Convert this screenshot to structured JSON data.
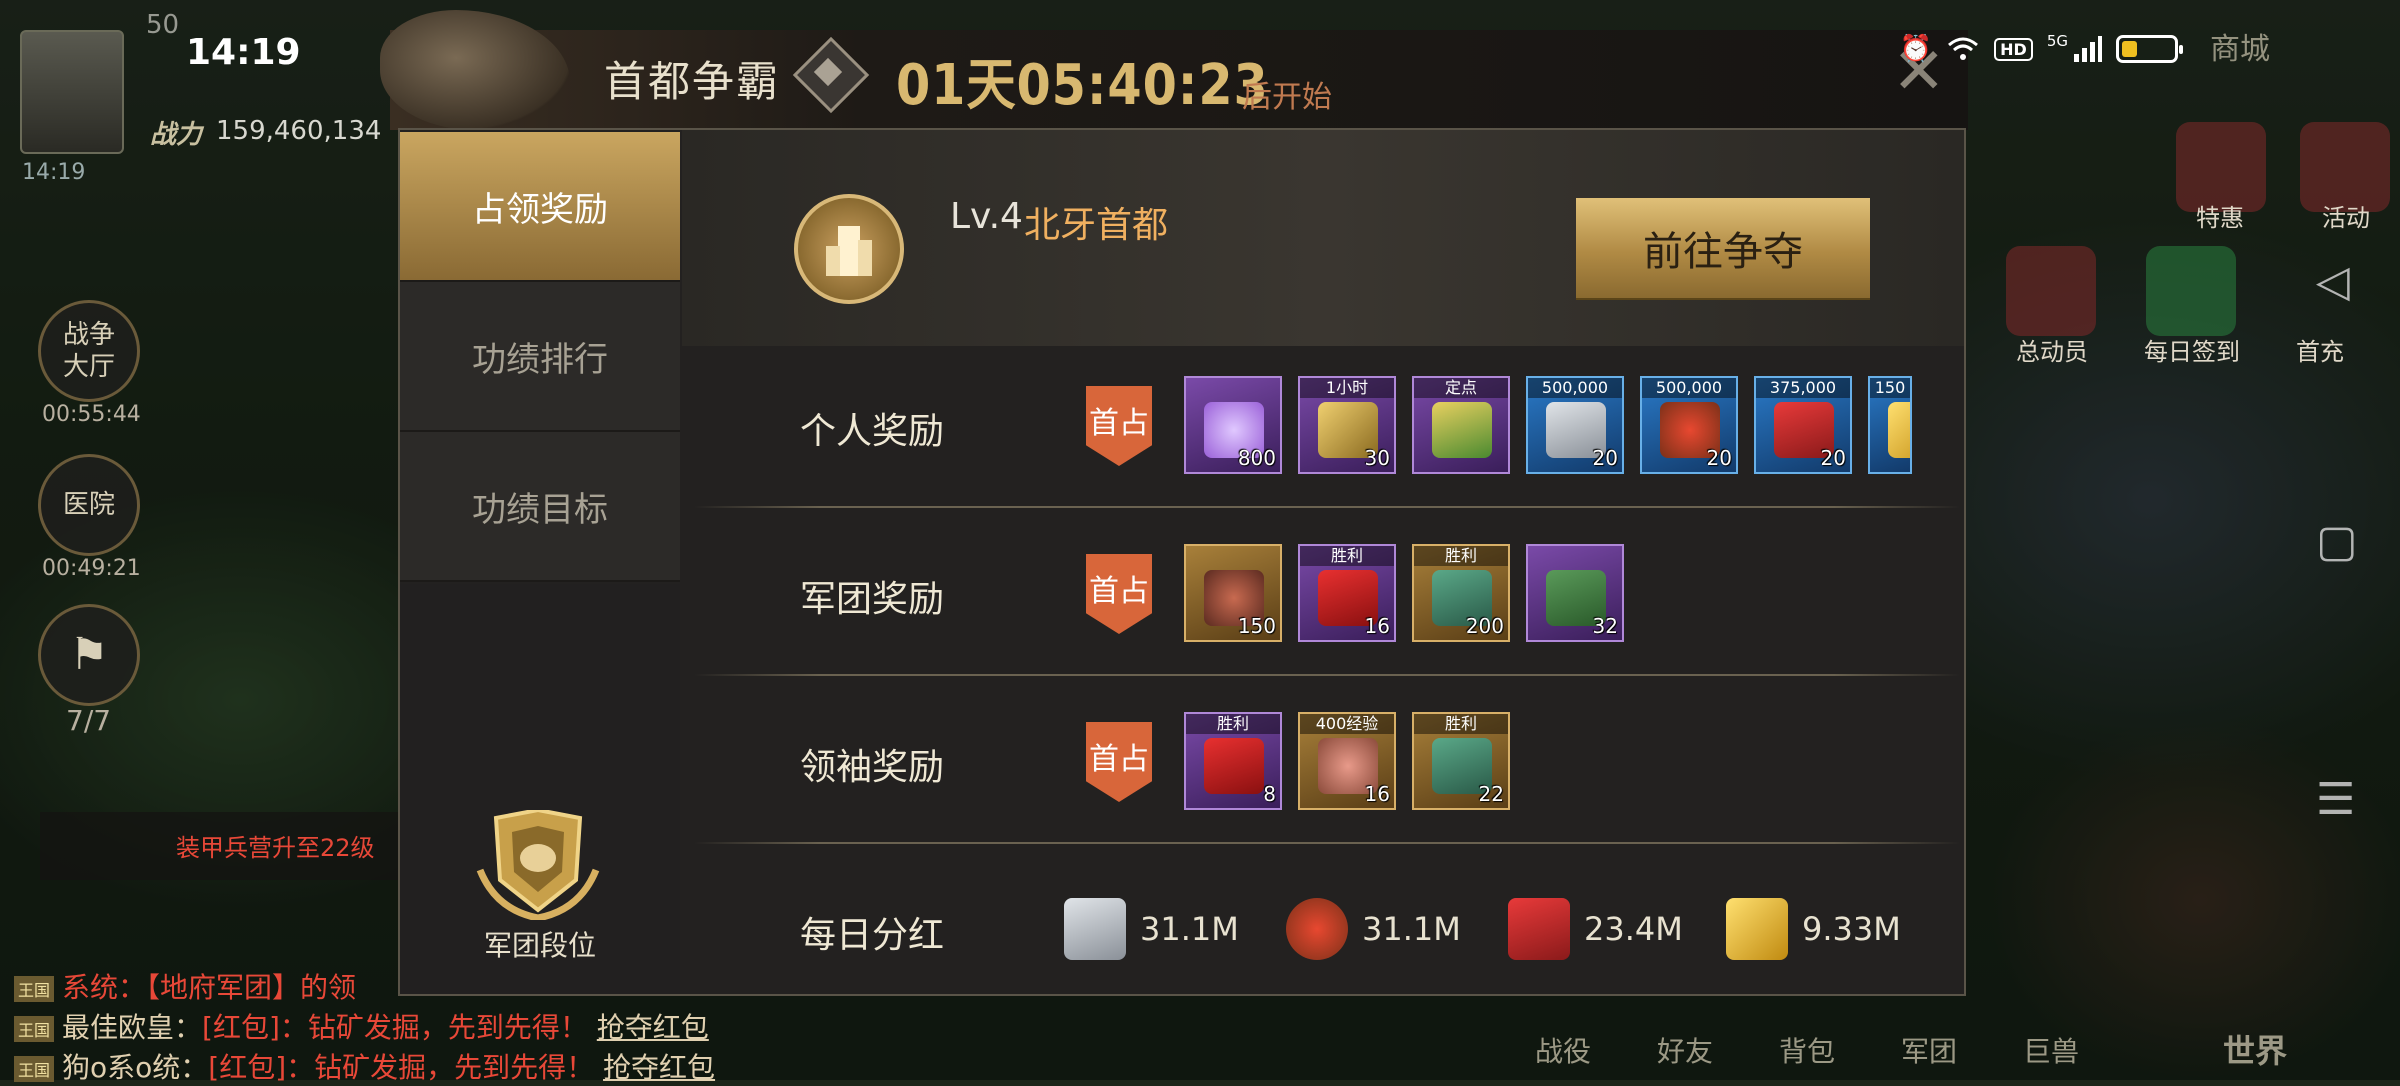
{
  "status_bar": {
    "time": "14:19",
    "hd": "HD",
    "network": "5G"
  },
  "hud": {
    "level": "50",
    "power_label": "战力",
    "power_value": "159,460,134",
    "avatar_time": "14:19",
    "war_hall": "战争大厅",
    "war_hall_timer": "00:55:44",
    "hospital": "医院",
    "hospital_timer": "00:49:21",
    "flag_count": "7/7",
    "notice": "装甲兵营升至22级",
    "shop": "商城"
  },
  "chat": [
    {
      "tag": "王国",
      "name": "系统：",
      "text": "【地府军团】的领",
      "link": ""
    },
    {
      "tag": "王国",
      "name": "最佳欧皇：",
      "text": "[红包]：钻矿发掘，先到先得！",
      "link": "抢夺红包"
    },
    {
      "tag": "王国",
      "name": "狗o系o统：",
      "text": "[红包]：钻矿发掘，先到先得！",
      "link": "抢夺红包"
    }
  ],
  "right_hud": {
    "icons": [
      "特惠",
      "活动",
      "总动员",
      "每日签到",
      "首充"
    ],
    "bottom_nav": [
      "战役",
      "好友",
      "背包",
      "军团",
      "巨兽",
      "世界"
    ]
  },
  "dialog": {
    "title": "首都争霸",
    "countdown": "01天05:40:23",
    "countdown_suffix": "后开始",
    "tabs": [
      "占领奖励",
      "功绩排行",
      "功绩目标"
    ],
    "active_tab": 0,
    "rank_label": "军团段位",
    "city_level": "Lv.4",
    "city_name": "北牙首都",
    "go_button": "前往争夺",
    "first_occupy": "首占",
    "rows": [
      {
        "label": "个人奖励",
        "items": [
          {
            "name": "diamond-ore",
            "color": "purple",
            "count": "800",
            "tag": ""
          },
          {
            "name": "speedup",
            "color": "purple",
            "count": "30",
            "tag": "1小时"
          },
          {
            "name": "relocate",
            "color": "purple",
            "count": "",
            "tag": "定点"
          },
          {
            "name": "steel",
            "color": "blue",
            "count": "20",
            "tag": "500,000"
          },
          {
            "name": "food",
            "color": "blue",
            "count": "20",
            "tag": "500,000"
          },
          {
            "name": "oil",
            "color": "blue",
            "count": "20",
            "tag": "375,000"
          },
          {
            "name": "gold",
            "color": "blue",
            "count": "",
            "tag": "150"
          }
        ]
      },
      {
        "label": "军团奖励",
        "items": [
          {
            "name": "beast-fragment",
            "color": "gold",
            "count": "150",
            "tag": ""
          },
          {
            "name": "red-packet",
            "color": "purple",
            "count": "16",
            "tag": "胜利"
          },
          {
            "name": "supply-crate",
            "color": "gold",
            "count": "200",
            "tag": "胜利"
          },
          {
            "name": "rank-book",
            "color": "purple",
            "count": "32",
            "tag": ""
          }
        ]
      },
      {
        "label": "领袖奖励",
        "items": [
          {
            "name": "red-packet",
            "color": "purple",
            "count": "8",
            "tag": "胜利"
          },
          {
            "name": "exp-meat",
            "color": "gold",
            "count": "16",
            "tag": "400经验"
          },
          {
            "name": "supply-crate",
            "color": "gold",
            "count": "22",
            "tag": "胜利"
          }
        ]
      }
    ],
    "daily_label": "每日分红",
    "daily": [
      {
        "name": "steel",
        "value": "31.1M"
      },
      {
        "name": "food",
        "value": "31.1M"
      },
      {
        "name": "oil",
        "value": "23.4M"
      },
      {
        "name": "gold",
        "value": "9.33M"
      }
    ],
    "battery_level": 0.3
  }
}
